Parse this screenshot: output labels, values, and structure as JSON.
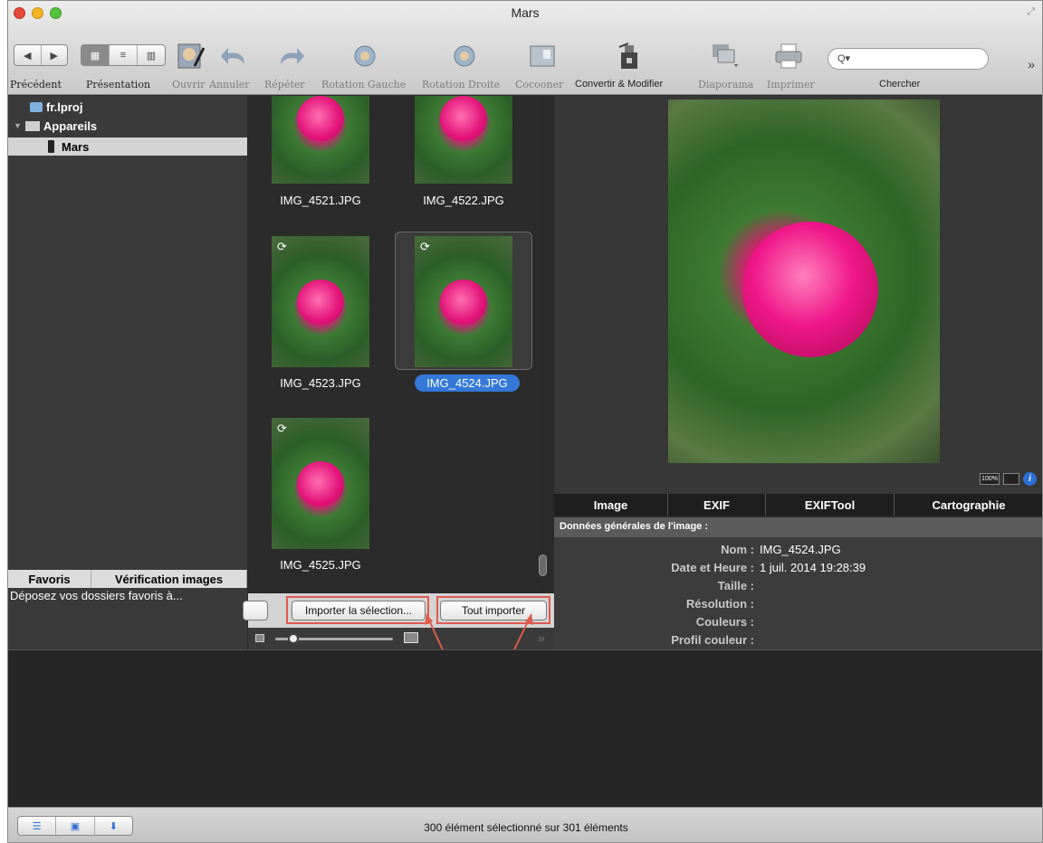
{
  "window": {
    "title": "Mars"
  },
  "toolbar": {
    "items": [
      {
        "label": "Précédent",
        "icon": "back-forward-icon",
        "enabled": true
      },
      {
        "label": "Présentation",
        "icon": "view-mode-icon",
        "enabled": true
      },
      {
        "label": "Ouvrir",
        "icon": "open-icon",
        "enabled": false
      },
      {
        "label": "Annuler",
        "icon": "undo-icon",
        "enabled": false
      },
      {
        "label": "Répéter",
        "icon": "redo-icon",
        "enabled": false
      },
      {
        "label": "Rotation Gauche",
        "icon": "rotate-left-icon",
        "enabled": false
      },
      {
        "label": "Rotation Droite",
        "icon": "rotate-right-icon",
        "enabled": false
      },
      {
        "label": "Cocooner",
        "icon": "cocoon-icon",
        "enabled": false
      },
      {
        "label": "Convertir & Modifier",
        "icon": "convert-icon",
        "enabled": true
      },
      {
        "label": "Diaporama",
        "icon": "slideshow-icon",
        "enabled": false
      },
      {
        "label": "Imprimer",
        "icon": "print-icon",
        "enabled": false
      }
    ],
    "search_label": "Chercher",
    "search_placeholder": "Q▾"
  },
  "sidebar": {
    "items": [
      {
        "label": "fr.lproj",
        "icon": "folder-icon"
      },
      {
        "label": "Appareils",
        "icon": "devices-icon"
      },
      {
        "label": "Mars",
        "icon": "phone-icon",
        "selected": true
      }
    ],
    "tabs": [
      "Favoris",
      "Vérification images"
    ],
    "favorites_hint": "Déposez vos dossiers favoris à..."
  },
  "thumbnails": [
    {
      "name": "IMG_4521.JPG",
      "sync": false,
      "selected": false
    },
    {
      "name": "IMG_4522.JPG",
      "sync": false,
      "selected": false
    },
    {
      "name": "IMG_4523.JPG",
      "sync": true,
      "selected": false
    },
    {
      "name": "IMG_4524.JPG",
      "sync": true,
      "selected": true
    },
    {
      "name": "IMG_4525.JPG",
      "sync": true,
      "selected": false
    }
  ],
  "import": {
    "selection_label": "Importer la sélection...",
    "all_label": "Tout importer"
  },
  "preview": {
    "badge_zoom": "100%"
  },
  "info": {
    "tabs": [
      "Image",
      "EXIF",
      "EXIFTool",
      "Cartographie"
    ],
    "header": "Données générales de l'image :",
    "rows": [
      {
        "key": "Nom :",
        "value": "IMG_4524.JPG"
      },
      {
        "key": "Date et Heure :",
        "value": "1 juil. 2014 19:28:39"
      },
      {
        "key": "Taille :",
        "value": ""
      },
      {
        "key": "Résolution :",
        "value": ""
      },
      {
        "key": "Couleurs :",
        "value": ""
      },
      {
        "key": "Profil couleur :",
        "value": ""
      }
    ]
  },
  "status": {
    "text": "300 élément sélectionné sur 301 éléments"
  },
  "colors": {
    "selection": "#3478d8",
    "highlight": "#e05a4e"
  }
}
